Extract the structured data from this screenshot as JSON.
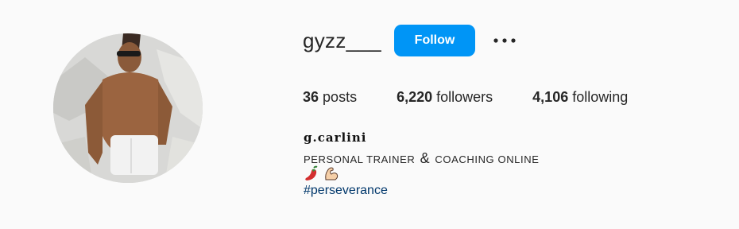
{
  "profile": {
    "username": "gyzz___",
    "follow_label": "Follow",
    "more_label": "•••",
    "stats": {
      "posts_count": "36",
      "posts_label": "posts",
      "followers_count": "6,220",
      "followers_label": "followers",
      "following_count": "4,106",
      "following_label": "following"
    },
    "full_name": "g.carlini",
    "bio_part1": "PERSONAL TRAINER",
    "bio_amp": "&",
    "bio_part2": "COACHING ONLINE",
    "bio_icons": [
      "chili-pepper-icon",
      "flexed-biceps-icon"
    ],
    "hashtag": "#perseverance"
  },
  "colors": {
    "background": "#fafafa",
    "follow_button": "#0095f6",
    "hashtag": "#00376b",
    "text": "#262626"
  }
}
